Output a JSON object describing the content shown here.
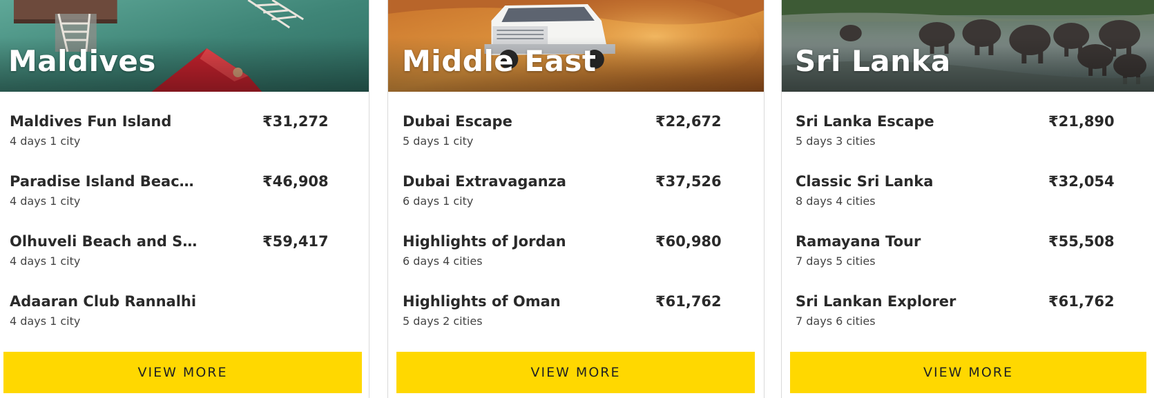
{
  "destinations": [
    {
      "title": "Maldives",
      "button_label": "VIEW MORE",
      "packages": [
        {
          "name": "Maldives Fun Island",
          "price": "₹31,272",
          "duration": "4 days 1 city"
        },
        {
          "name": "Paradise Island Beach...",
          "price": "₹46,908",
          "duration": "4 days 1 city"
        },
        {
          "name": "Olhuveli Beach and Sp...",
          "price": "₹59,417",
          "duration": "4 days 1 city"
        },
        {
          "name": "Adaaran Club Rannalhi",
          "price": "",
          "duration": "4 days 1 city"
        }
      ]
    },
    {
      "title": "Middle East",
      "button_label": "VIEW MORE",
      "packages": [
        {
          "name": "Dubai Escape",
          "price": "₹22,672",
          "duration": "5 days 1 city"
        },
        {
          "name": "Dubai Extravaganza",
          "price": "₹37,526",
          "duration": "6 days 1 city"
        },
        {
          "name": "Highlights of Jordan",
          "price": "₹60,980",
          "duration": "6 days 4 cities"
        },
        {
          "name": "Highlights of Oman",
          "price": "₹61,762",
          "duration": "5 days 2 cities"
        }
      ]
    },
    {
      "title": "Sri Lanka",
      "button_label": "VIEW MORE",
      "packages": [
        {
          "name": "Sri Lanka Escape",
          "price": "₹21,890",
          "duration": "5 days 3 cities"
        },
        {
          "name": "Classic Sri Lanka",
          "price": "₹32,054",
          "duration": "8 days 4 cities"
        },
        {
          "name": "Ramayana Tour",
          "price": "₹55,508",
          "duration": "7 days 5 cities"
        },
        {
          "name": "Sri Lankan Explorer",
          "price": "₹61,762",
          "duration": "7 days 6 cities"
        }
      ]
    }
  ],
  "colors": {
    "accent_button": "#ffd800",
    "text_primary": "#2a2a2a",
    "text_secondary": "#444444"
  }
}
